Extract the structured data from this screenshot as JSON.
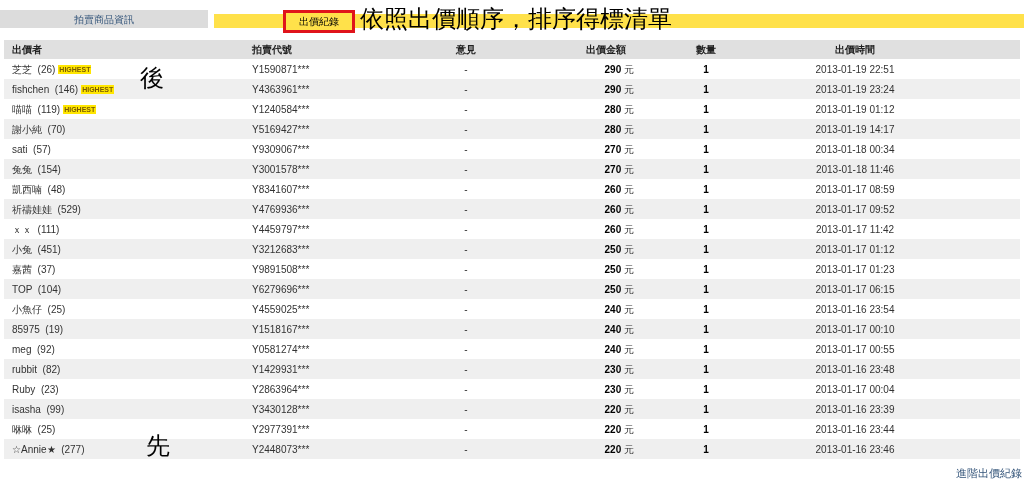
{
  "tabs": [
    {
      "label": "拍賣商品資訊",
      "selected": false
    },
    {
      "label": "出價紀錄",
      "selected": true
    }
  ],
  "annotation": {
    "title": "依照出價順序，排序得標清單",
    "top_marker": "後",
    "bottom_marker": "先"
  },
  "table": {
    "columns": [
      "出價者",
      "拍賣代號",
      "意見",
      "出價金額",
      "數量",
      "出價時間"
    ],
    "rows": [
      {
        "bidder": "芝芝",
        "rating": "(26)",
        "badge": "HIGHEST",
        "code": "Y1590871***",
        "comment": "-",
        "amount": "290",
        "unit": "元",
        "qty": "1",
        "time": "2013-01-19 22:51"
      },
      {
        "bidder": "fishchen",
        "rating": "(146)",
        "badge": "HIGHEST",
        "code": "Y4363961***",
        "comment": "-",
        "amount": "290",
        "unit": "元",
        "qty": "1",
        "time": "2013-01-19 23:24"
      },
      {
        "bidder": "喵喵",
        "rating": "(119)",
        "badge": "HIGHEST",
        "code": "Y1240584***",
        "comment": "-",
        "amount": "280",
        "unit": "元",
        "qty": "1",
        "time": "2013-01-19 01:12"
      },
      {
        "bidder": "謝小純",
        "rating": "(70)",
        "code": "Y5169427***",
        "comment": "-",
        "amount": "280",
        "unit": "元",
        "qty": "1",
        "time": "2013-01-19 14:17"
      },
      {
        "bidder": "sati",
        "rating": "(57)",
        "code": "Y9309067***",
        "comment": "-",
        "amount": "270",
        "unit": "元",
        "qty": "1",
        "time": "2013-01-18 00:34"
      },
      {
        "bidder": "兔兔",
        "rating": "(154)",
        "code": "Y3001578***",
        "comment": "-",
        "amount": "270",
        "unit": "元",
        "qty": "1",
        "time": "2013-01-18 11:46"
      },
      {
        "bidder": "凱西喃",
        "rating": "(48)",
        "code": "Y8341607***",
        "comment": "-",
        "amount": "260",
        "unit": "元",
        "qty": "1",
        "time": "2013-01-17 08:59"
      },
      {
        "bidder": "祈禱娃娃",
        "rating": "(529)",
        "code": "Y4769936***",
        "comment": "-",
        "amount": "260",
        "unit": "元",
        "qty": "1",
        "time": "2013-01-17 09:52"
      },
      {
        "bidder": "ｘｘ",
        "rating": "(111)",
        "code": "Y4459797***",
        "comment": "-",
        "amount": "260",
        "unit": "元",
        "qty": "1",
        "time": "2013-01-17 11:42"
      },
      {
        "bidder": "小兔",
        "rating": "(451)",
        "code": "Y3212683***",
        "comment": "-",
        "amount": "250",
        "unit": "元",
        "qty": "1",
        "time": "2013-01-17 01:12"
      },
      {
        "bidder": "嘉茜",
        "rating": "(37)",
        "code": "Y9891508***",
        "comment": "-",
        "amount": "250",
        "unit": "元",
        "qty": "1",
        "time": "2013-01-17 01:23"
      },
      {
        "bidder": "TOP",
        "rating": "(104)",
        "code": "Y6279696***",
        "comment": "-",
        "amount": "250",
        "unit": "元",
        "qty": "1",
        "time": "2013-01-17 06:15"
      },
      {
        "bidder": "小魚仔",
        "rating": "(25)",
        "code": "Y4559025***",
        "comment": "-",
        "amount": "240",
        "unit": "元",
        "qty": "1",
        "time": "2013-01-16 23:54"
      },
      {
        "bidder": "85975",
        "rating": "(19)",
        "code": "Y1518167***",
        "comment": "-",
        "amount": "240",
        "unit": "元",
        "qty": "1",
        "time": "2013-01-17 00:10"
      },
      {
        "bidder": "meg",
        "rating": "(92)",
        "code": "Y0581274***",
        "comment": "-",
        "amount": "240",
        "unit": "元",
        "qty": "1",
        "time": "2013-01-17 00:55"
      },
      {
        "bidder": "rubbit",
        "rating": "(82)",
        "code": "Y1429931***",
        "comment": "-",
        "amount": "230",
        "unit": "元",
        "qty": "1",
        "time": "2013-01-16 23:48"
      },
      {
        "bidder": "Ruby",
        "rating": "(23)",
        "code": "Y2863964***",
        "comment": "-",
        "amount": "230",
        "unit": "元",
        "qty": "1",
        "time": "2013-01-17 00:04"
      },
      {
        "bidder": "isasha",
        "rating": "(99)",
        "code": "Y3430128***",
        "comment": "-",
        "amount": "220",
        "unit": "元",
        "qty": "1",
        "time": "2013-01-16 23:39"
      },
      {
        "bidder": "咻咻",
        "rating": "(25)",
        "code": "Y2977391***",
        "comment": "-",
        "amount": "220",
        "unit": "元",
        "qty": "1",
        "time": "2013-01-16 23:44"
      },
      {
        "bidder": "☆Annie★",
        "rating": "(277)",
        "code": "Y2448073***",
        "comment": "-",
        "amount": "220",
        "unit": "元",
        "qty": "1",
        "time": "2013-01-16 23:46"
      }
    ]
  },
  "footer_link": "進階出價紀錄"
}
